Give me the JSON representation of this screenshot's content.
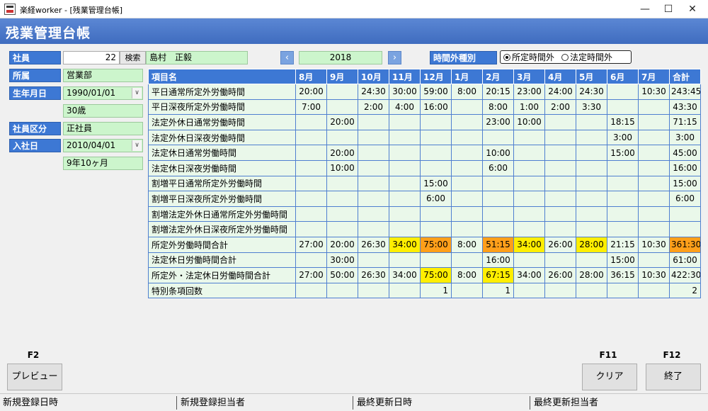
{
  "window": {
    "title": "楽経worker - [残業管理台帳]",
    "min": "—",
    "max": "☐",
    "close": "✕"
  },
  "header": {
    "title": "残業管理台帳"
  },
  "employee": {
    "label_employee": "社員",
    "employee_no": "22",
    "search_label": "検索",
    "name": "島村　正毅",
    "label_dept": "所属",
    "dept": "営業部",
    "label_birth": "生年月日",
    "birth_date": "1990/01/01",
    "age": "30歳",
    "label_type": "社員区分",
    "type": "正社員",
    "label_join": "入社日",
    "join_date": "2010/04/01",
    "tenure": "9年10ヶ月"
  },
  "year_nav": {
    "prev": "‹",
    "year": "2018",
    "next": "›"
  },
  "overtime_type": {
    "label": "時間外種別",
    "option1": "所定時間外",
    "option2": "法定時間外",
    "selected": "所定時間外"
  },
  "table": {
    "headers": [
      "項目名",
      "8月",
      "9月",
      "10月",
      "11月",
      "12月",
      "1月",
      "2月",
      "3月",
      "4月",
      "5月",
      "6月",
      "7月",
      "合計"
    ],
    "rows": [
      {
        "name": "平日通常所定外労働時間",
        "cells": [
          "20:00",
          "",
          "24:30",
          "30:00",
          "59:00",
          "8:00",
          "20:15",
          "23:00",
          "24:00",
          "24:30",
          "",
          "10:30",
          "243:45"
        ]
      },
      {
        "name": "平日深夜所定外労働時間",
        "cells": [
          "7:00",
          "",
          "2:00",
          "4:00",
          "16:00",
          "",
          "8:00",
          "1:00",
          "2:00",
          "3:30",
          "",
          "",
          "43:30"
        ]
      },
      {
        "name": "法定外休日通常労働時間",
        "cells": [
          "",
          "20:00",
          "",
          "",
          "",
          "",
          "23:00",
          "10:00",
          "",
          "",
          "18:15",
          "",
          "71:15"
        ]
      },
      {
        "name": "法定外休日深夜労働時間",
        "cells": [
          "",
          "",
          "",
          "",
          "",
          "",
          "",
          "",
          "",
          "",
          "3:00",
          "",
          "3:00"
        ]
      },
      {
        "name": "法定休日通常労働時間",
        "cells": [
          "",
          "20:00",
          "",
          "",
          "",
          "",
          "10:00",
          "",
          "",
          "",
          "15:00",
          "",
          "45:00"
        ]
      },
      {
        "name": "法定休日深夜労働時間",
        "cells": [
          "",
          "10:00",
          "",
          "",
          "",
          "",
          "6:00",
          "",
          "",
          "",
          "",
          "",
          "16:00"
        ]
      },
      {
        "name": "割増平日通常所定外労働時間",
        "cells": [
          "",
          "",
          "",
          "",
          "15:00",
          "",
          "",
          "",
          "",
          "",
          "",
          "",
          "15:00"
        ]
      },
      {
        "name": "割増平日深夜所定外労働時間",
        "cells": [
          "",
          "",
          "",
          "",
          "6:00",
          "",
          "",
          "",
          "",
          "",
          "",
          "",
          "6:00"
        ]
      },
      {
        "name": "割増法定外休日通常所定外労働時間",
        "cells": [
          "",
          "",
          "",
          "",
          "",
          "",
          "",
          "",
          "",
          "",
          "",
          "",
          ""
        ]
      },
      {
        "name": "割増法定外休日深夜所定外労働時間",
        "cells": [
          "",
          "",
          "",
          "",
          "",
          "",
          "",
          "",
          "",
          "",
          "",
          "",
          ""
        ]
      },
      {
        "name": "所定外労働時間合計",
        "cells": [
          "27:00",
          "20:00",
          "26:30",
          "34:00",
          "75:00",
          "8:00",
          "51:15",
          "34:00",
          "26:00",
          "28:00",
          "21:15",
          "10:30",
          "361:30"
        ]
      },
      {
        "name": "法定休日労働時間合計",
        "cells": [
          "",
          "30:00",
          "",
          "",
          "",
          "",
          "16:00",
          "",
          "",
          "",
          "15:00",
          "",
          "61:00"
        ]
      },
      {
        "name": "所定外・法定休日労働時間合計",
        "cells": [
          "27:00",
          "50:00",
          "26:30",
          "34:00",
          "75:00",
          "8:00",
          "67:15",
          "34:00",
          "26:00",
          "28:00",
          "36:15",
          "10:30",
          "422:30"
        ]
      },
      {
        "name": "特別条項回数",
        "cells": [
          "",
          "",
          "",
          "",
          "1",
          "",
          "1",
          "",
          "",
          "",
          "",
          "",
          "2"
        ]
      }
    ],
    "highlight_colors": {
      "yellow": "#ffee00",
      "orange": "#ff9f1a"
    }
  },
  "footer": {
    "f2_key": "F2",
    "preview_label": "プレビュー",
    "f11_key": "F11",
    "clear_label": "クリア",
    "f12_key": "F12",
    "exit_label": "終了"
  },
  "status": {
    "created_at": "新規登録日時",
    "created_by": "新規登録担当者",
    "updated_at": "最終更新日時",
    "updated_by": "最終更新担当者"
  }
}
